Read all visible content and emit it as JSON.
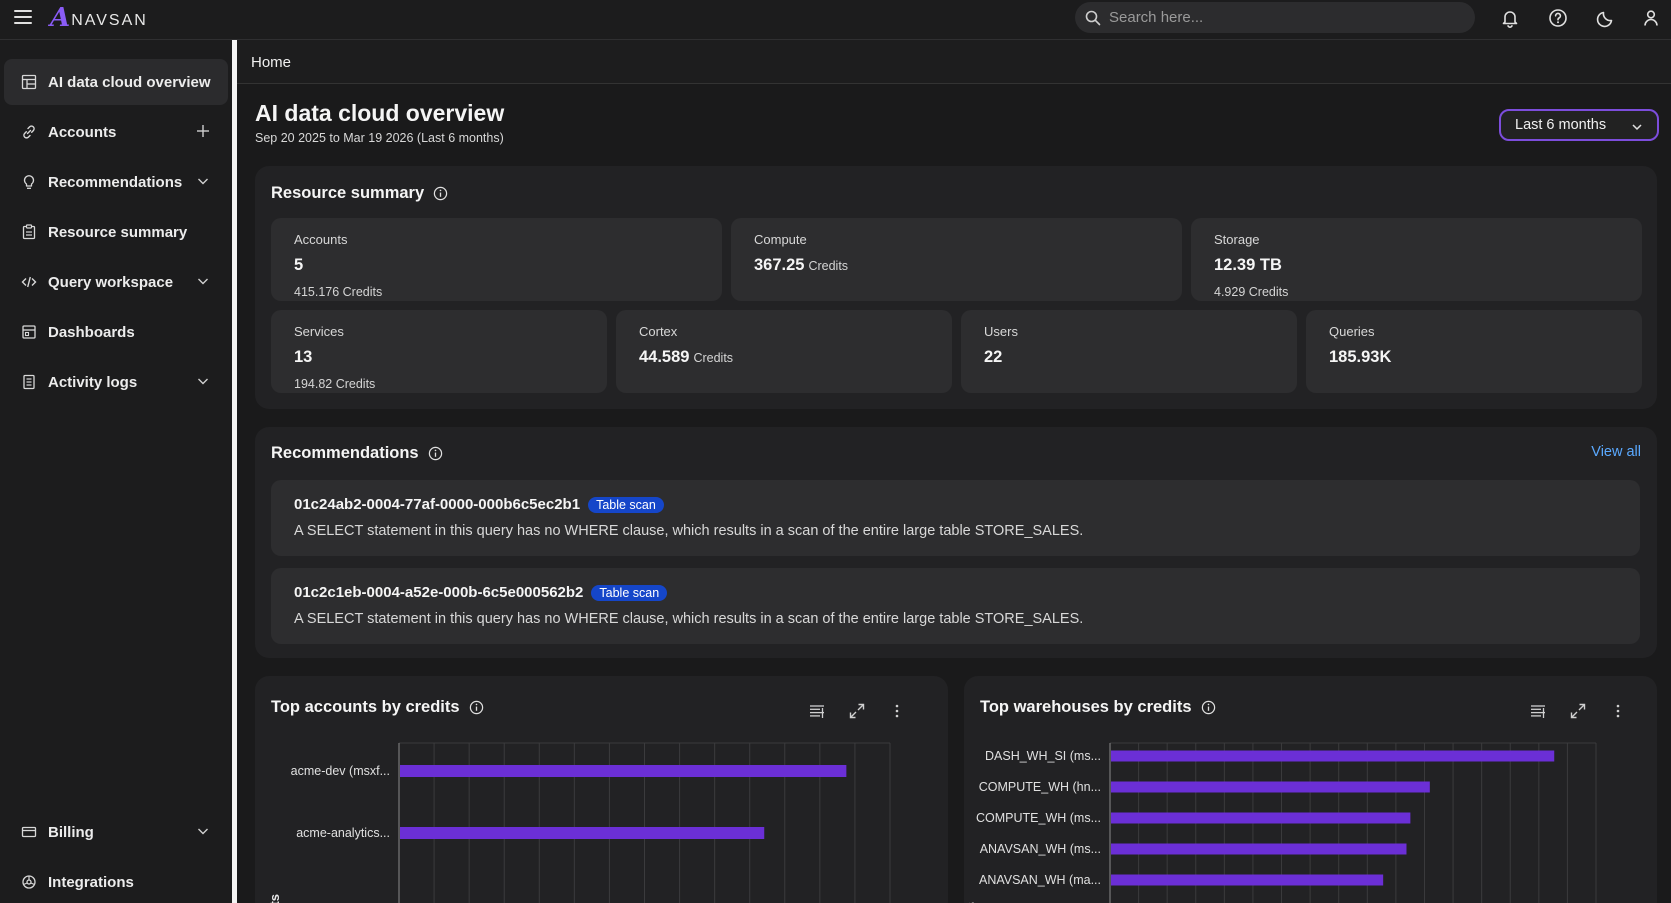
{
  "app": {
    "logo_mark": "A",
    "logo_text": "NAVSAN",
    "search_placeholder": "Search here..."
  },
  "icons": {
    "menu": "hamburger-icon",
    "search": "search-icon",
    "notifications": "bell-icon",
    "help": "help-icon",
    "theme": "moon-icon",
    "profile": "user-icon"
  },
  "sidebar": {
    "items": [
      {
        "label": "AI data cloud overview",
        "icon": "dashboard-icon",
        "active": true
      },
      {
        "label": "Accounts",
        "icon": "link-icon",
        "right": "plus-icon"
      },
      {
        "label": "Recommendations",
        "icon": "lightbulb-icon",
        "right": "chevron-down-icon"
      },
      {
        "label": "Resource summary",
        "icon": "clipboard-icon"
      },
      {
        "label": "Query workspace",
        "icon": "code-icon",
        "right": "chevron-down-icon"
      },
      {
        "label": "Dashboards",
        "icon": "grid-icon"
      },
      {
        "label": "Activity logs",
        "icon": "log-icon",
        "right": "chevron-down-icon"
      },
      {
        "label": "Billing",
        "icon": "billing-icon",
        "right": "chevron-down-icon"
      },
      {
        "label": "Integrations",
        "icon": "integrations-icon"
      }
    ]
  },
  "breadcrumb": "Home",
  "page": {
    "title": "AI data cloud overview",
    "subtitle": "Sep 20 2025 to Mar 19 2026 (Last 6 months)",
    "range_label": "Last 6 months"
  },
  "resource_summary": {
    "title": "Resource summary",
    "cards": [
      {
        "label": "Accounts",
        "value": "5",
        "unit": "",
        "sub": "415.176 Credits"
      },
      {
        "label": "Compute",
        "value": "367.25",
        "unit": "Credits",
        "sub": ""
      },
      {
        "label": "Storage",
        "value": "12.39 TB",
        "unit": "",
        "sub": "4.929 Credits"
      },
      {
        "label": "Services",
        "value": "13",
        "unit": "",
        "sub": "194.82 Credits"
      },
      {
        "label": "Cortex",
        "value": "44.589",
        "unit": "Credits",
        "sub": ""
      },
      {
        "label": "Users",
        "value": "22",
        "unit": "",
        "sub": ""
      },
      {
        "label": "Queries",
        "value": "185.93K",
        "unit": "",
        "sub": ""
      }
    ]
  },
  "recommendations": {
    "title": "Recommendations",
    "view_all": "View all",
    "items": [
      {
        "id": "01c24ab2-0004-77af-0000-000b6c5ec2b1",
        "tag": "Table scan",
        "description": "A SELECT statement in this query has no WHERE clause, which results in a scan of the entire large table STORE_SALES."
      },
      {
        "id": "01c2c1eb-0004-a52e-000b-6c5e000562b2",
        "tag": "Table scan",
        "description": "A SELECT statement in this query has no WHERE clause, which results in a scan of the entire large table STORE_SALES."
      }
    ]
  },
  "top_accounts": {
    "title": "Top accounts by credits",
    "axis_label_fragment": "nts",
    "bar_color": "#6b2fd6"
  },
  "top_warehouses": {
    "title": "Top warehouses by credits",
    "axis_label_fragment": "uses",
    "bar_color": "#6b2fd6"
  },
  "chart_data": [
    {
      "type": "bar",
      "orientation": "horizontal",
      "title": "Top accounts by credits",
      "categories": [
        "acme-dev (msxf...",
        "acme-analytics..."
      ],
      "values": [
        250,
        204
      ],
      "xlim": [
        0,
        275
      ],
      "grid": true
    },
    {
      "type": "bar",
      "orientation": "horizontal",
      "title": "Top warehouses by credits",
      "categories": [
        "DASH_WH_SI (ms...",
        "COMPUTE_WH (hn...",
        "COMPUTE_WH (ms...",
        "ANAVSAN_WH (ms...",
        "ANAVSAN_WH (ma..."
      ],
      "values": [
        114,
        82,
        77,
        76,
        70
      ],
      "xlim": [
        0,
        125
      ],
      "grid": true
    }
  ]
}
